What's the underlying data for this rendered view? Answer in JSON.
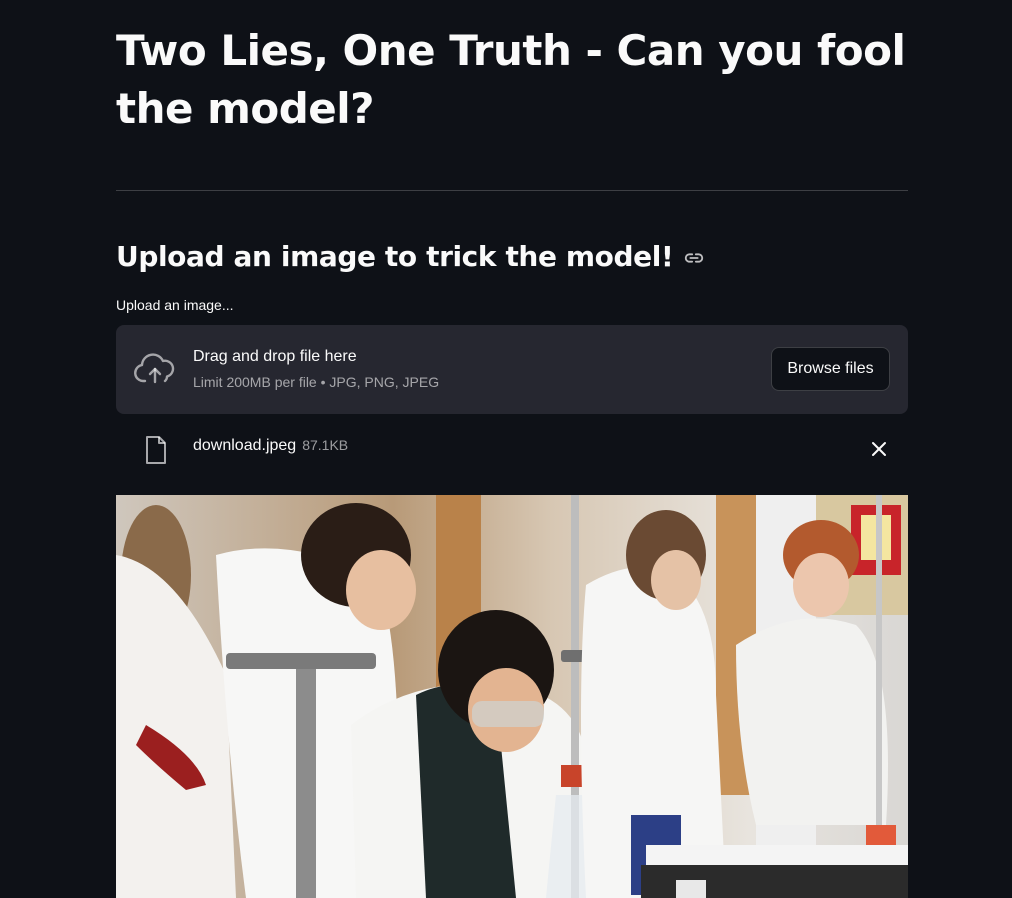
{
  "page": {
    "title": "Two Lies, One Truth - Can you fool the model?",
    "subheader": "Upload an image to trick the model!",
    "link_icon": "link-icon"
  },
  "uploader": {
    "label": "Upload an image...",
    "dropzone_primary": "Drag and drop file here",
    "dropzone_secondary": "Limit 200MB per file • JPG, PNG, JPEG",
    "browse_label": "Browse files",
    "upload_icon": "cloud-upload-icon"
  },
  "file": {
    "name": "download.jpeg",
    "size": "87.1KB",
    "file_icon": "file-icon",
    "remove_icon": "close-icon"
  },
  "colors": {
    "background": "#0e1117",
    "surface": "#262730",
    "text": "#fafafa"
  }
}
